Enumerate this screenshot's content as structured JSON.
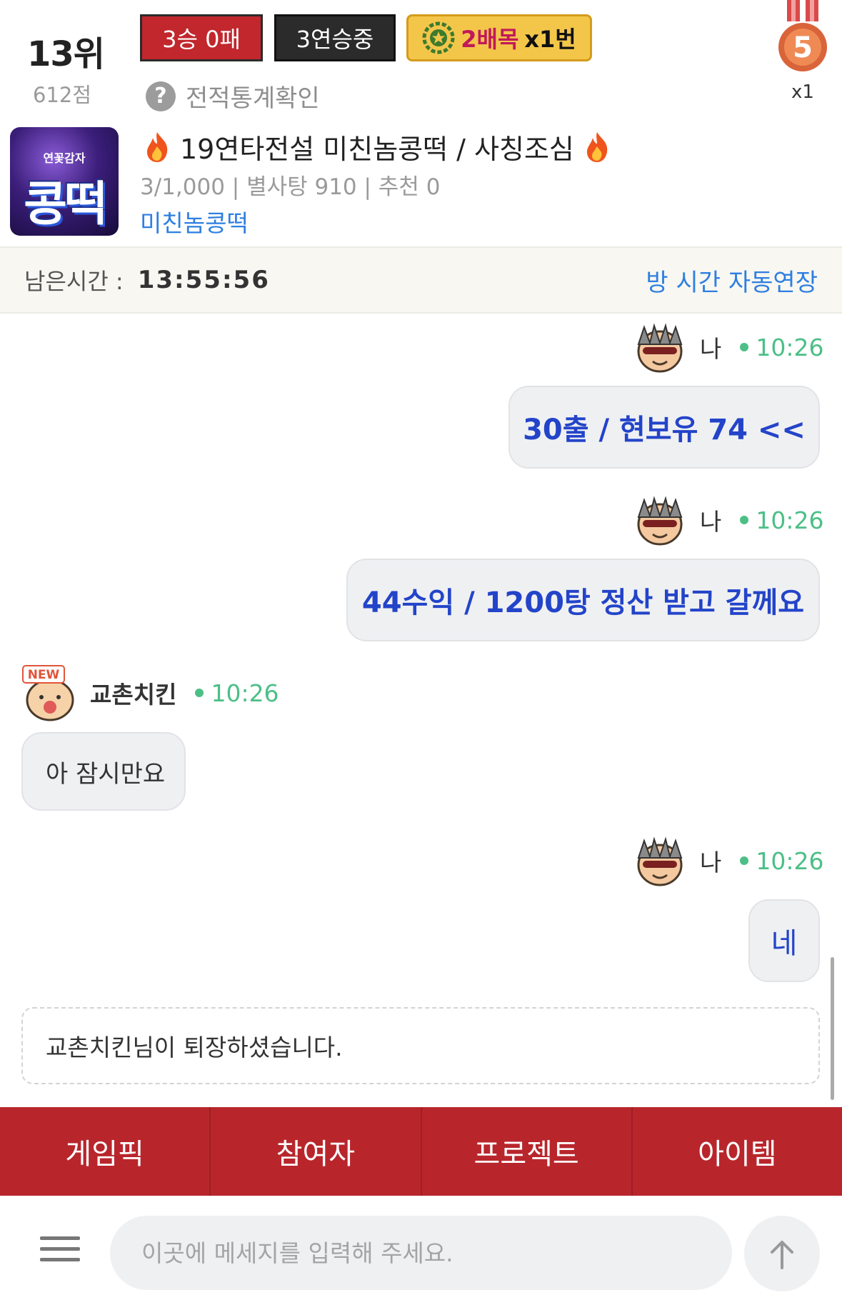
{
  "header": {
    "rank": "13위",
    "score": "612점",
    "record_badge": "3승 0패",
    "streak_badge": "3연승중",
    "multiplier_label": "2배목",
    "multiplier_count": "x1번",
    "stats_link": "전적통계확인",
    "medal_number": "5",
    "medal_count": "x1"
  },
  "room": {
    "logo_small": "연꽃감자",
    "logo_big": "콩떡",
    "title": "19연타전설 미친놈콩떡 / 사칭조심",
    "meta": "3/1,000 | 별사탕 910 | 추천 0",
    "host": "미친놈콩떡"
  },
  "timer": {
    "label": "남은시간 :",
    "value": "13:55:56",
    "auto_extend": "방 시간 자동연장"
  },
  "messages": [
    {
      "sender": "나",
      "time": "10:26",
      "text": "30출 / 현보유 74 <<",
      "mine": true
    },
    {
      "sender": "나",
      "time": "10:26",
      "text": "44수익 / 1200탕 정산 받고 갈께요",
      "mine": true
    },
    {
      "sender": "교촌치킨",
      "time": "10:26",
      "text": "아 잠시만요",
      "mine": false,
      "avatar_badge": "NEW"
    },
    {
      "sender": "나",
      "time": "10:26",
      "text": "네",
      "mine": true
    }
  ],
  "system_notice": "교촌치킨님이 퇴장하셨습니다.",
  "tabs": [
    "게임픽",
    "참여자",
    "프로젝트",
    "아이템"
  ],
  "input": {
    "placeholder": "이곳에 메세지를 입력해 주세요."
  },
  "colors": {
    "accent_red": "#b8262c",
    "link_blue": "#2e7fe0",
    "message_blue": "#2344c9",
    "online_green": "#4cbf87",
    "gold": "#f3c64a"
  },
  "icons": [
    "help-icon",
    "wreath-icon",
    "medal-icon",
    "fire-icon",
    "avatar-icon",
    "menu-icon",
    "arrow-up-icon"
  ]
}
